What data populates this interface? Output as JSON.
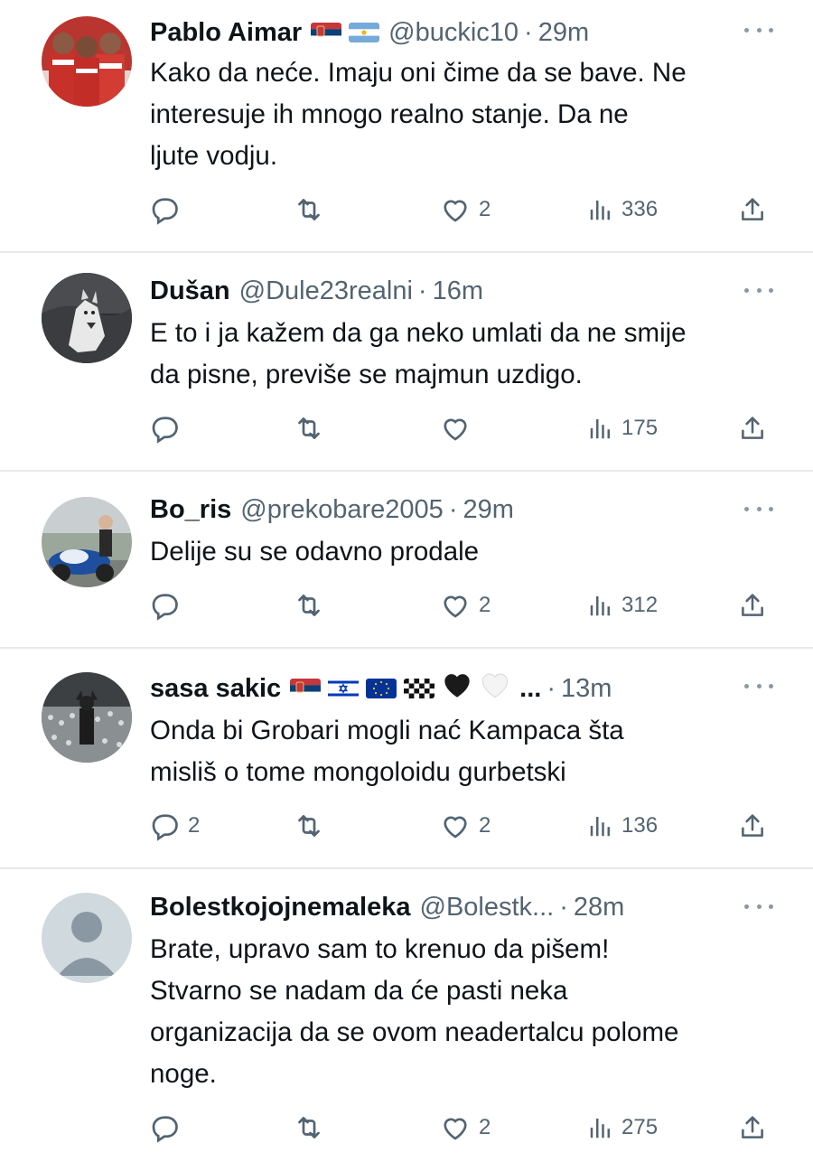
{
  "colors": {
    "text_primary": "#0f1419",
    "text_secondary": "#536471",
    "divider": "#e7e9ea"
  },
  "tweets": [
    {
      "name": "Pablo Aimar",
      "flags": [
        "serbia-flag",
        "argentina-flag"
      ],
      "handle": "@buckic10",
      "separator": "·",
      "time": "29m",
      "text": "Kako da neće. Imaju oni čime da se bave. Ne\ninteresuje ih mnogo realno stanje. Da ne\nljute vodju.",
      "reply_count": "",
      "like_count": "2",
      "view_count": "336"
    },
    {
      "name": "Dušan",
      "flags": [],
      "handle": "@Dule23realni",
      "separator": "·",
      "time": "16m",
      "text": "E to i ja kažem da ga neko umlati da ne smije\nda pisne, previše se majmun uzdigo.",
      "reply_count": "",
      "like_count": "",
      "view_count": "175"
    },
    {
      "name": "Bo_ris",
      "flags": [],
      "handle": "@prekobare2005",
      "separator": "·",
      "time": "29m",
      "text": "Delije su se odavno prodale",
      "reply_count": "",
      "like_count": "2",
      "view_count": "312"
    },
    {
      "name": "sasa sakic",
      "flags": [
        "serbia-flag",
        "israel-flag",
        "eu-flag",
        "checkered-flag",
        "black-heart",
        "white-heart"
      ],
      "ellipsis": "...",
      "handle": "",
      "separator": "·",
      "time": "13m",
      "text": "Onda bi Grobari mogli nać Kampaca šta\nmisliš o tome mongoloidu gurbetski",
      "reply_count": "2",
      "like_count": "2",
      "view_count": "136"
    },
    {
      "name": "Bolestkojojnemaleka",
      "flags": [],
      "handle": "@Bolestk...",
      "separator": "·",
      "time": "28m",
      "text": "Brate, upravo sam to krenuo da pišem!\nStvarno se nadam da će pasti neka\norganizacija da se ovom neadertalcu polome\nnoge.",
      "reply_count": "",
      "like_count": "2",
      "view_count": "275"
    }
  ]
}
